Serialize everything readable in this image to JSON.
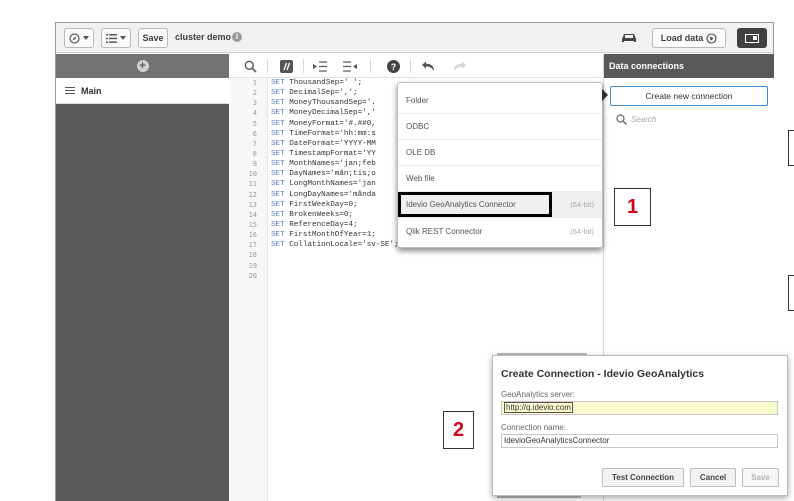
{
  "toolbar": {
    "save_label": "Save",
    "app_title": "cluster demo",
    "info_glyph": "i",
    "load_label": "Load data"
  },
  "sidebar": {
    "add_glyph": "+",
    "items": [
      {
        "label": "Main"
      }
    ]
  },
  "editor": {
    "line_numbers": [
      "1",
      "2",
      "3",
      "4",
      "5",
      "6",
      "7",
      "8",
      "9",
      "10",
      "11",
      "12",
      "13",
      "14",
      "15",
      "16",
      "17",
      "18",
      "19",
      "20"
    ],
    "keyword": "SET",
    "lines": [
      "ThousandSep=' ';",
      "DecimalSep=',';",
      "MoneyThousandSep='.",
      "MoneyDecimalSep=','",
      "MoneyFormat='#.##0,",
      "TimeFormat='hh:mm:s",
      "DateFormat='YYYY-MM",
      "TimestampFormat='YY",
      "MonthNames='jan;feb",
      "DayNames='mån;tis;o",
      "LongMonthNames='jan",
      "LongDayNames='månda",
      "FirstWeekDay=0;",
      "BrokenWeeks=0;",
      "ReferenceDay=4;",
      "FirstMonthOfYear=1;",
      "CollationLocale='sv-SE';",
      "",
      "",
      ""
    ]
  },
  "data_connections": {
    "title": "Data connections",
    "create_label": "Create new connection",
    "search_placeholder": "Search"
  },
  "menu": {
    "items": [
      {
        "label": "Folder",
        "bits": ""
      },
      {
        "label": "ODBC",
        "bits": ""
      },
      {
        "label": "OLE DB",
        "bits": ""
      },
      {
        "label": "Web file",
        "bits": ""
      },
      {
        "label": "Idevio GeoAnalytics Connector",
        "bits": "(64-bit)"
      },
      {
        "label": "Qlik REST Connector",
        "bits": "(64-bit)"
      }
    ]
  },
  "callouts": {
    "one": "1",
    "two": "2"
  },
  "dialog": {
    "title": "Create Connection - Idevio GeoAnalytics",
    "server_label": "GeoAnalytics server:",
    "server_value": "http://q.idevio.com",
    "name_label": "Connection name:",
    "name_value": "IdevioGeoAnalyticsConnector",
    "test_label": "Test Connection",
    "cancel_label": "Cancel",
    "save_label": "Save"
  },
  "colors": {
    "accent_blue": "#3d8fd1",
    "callout_red": "#d0021b",
    "sidebar_dark": "#595959",
    "keyword_blue": "#5b80c7",
    "input_highlight": "#fbfbd0"
  },
  "icons": [
    "compass-icon",
    "list-icon",
    "info-icon",
    "car-icon",
    "play-icon",
    "panel-toggle-icon",
    "plus-icon",
    "hamburger-icon",
    "search-icon",
    "comment-icon",
    "indent-icon",
    "outdent-icon",
    "help-icon",
    "undo-icon",
    "redo-icon"
  ]
}
